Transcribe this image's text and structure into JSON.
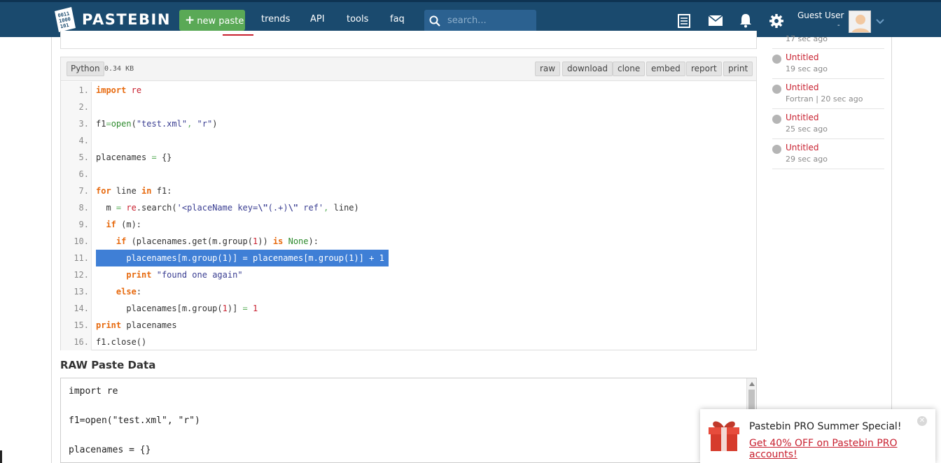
{
  "header": {
    "logo_text": "PASTEBIN",
    "new_paste": "new paste",
    "nav": [
      "trends",
      "API",
      "tools",
      "faq"
    ],
    "search_placeholder": "search...",
    "user_name": "Guest User",
    "user_sub": "-"
  },
  "paste": {
    "language": "Python",
    "size": "0.34 KB",
    "toolbar": [
      "raw",
      "download",
      "clone",
      "embed",
      "report",
      "print"
    ],
    "line_numbers": [
      "1.",
      "2.",
      "3.",
      "4.",
      "5.",
      "6.",
      "7.",
      "8.",
      "9.",
      "10.",
      "11.",
      "12.",
      "13.",
      "14.",
      "15.",
      "16."
    ]
  },
  "raw": {
    "title": "RAW Paste Data",
    "lines": [
      "import re",
      "f1=open(\"test.xml\", \"r\")",
      "placenames = {}"
    ]
  },
  "sidebar": {
    "top_meta": "17 sec ago",
    "items": [
      {
        "title": "Untitled",
        "meta": "19 sec ago"
      },
      {
        "title": "Untitled",
        "meta": "Fortran | 20 sec ago"
      },
      {
        "title": "Untitled",
        "meta": "25 sec ago"
      },
      {
        "title": "Untitled",
        "meta": "29 sec ago"
      }
    ]
  },
  "promo": {
    "title": "Pastebin PRO Summer Special!",
    "link": "Get 40% OFF on Pastebin PRO accounts!"
  },
  "colors": {
    "header_bg": "#1a4a6e",
    "new_paste_green": "#5aa956",
    "link_red": "#c8202f",
    "selection_blue": "#3f7fd6"
  }
}
